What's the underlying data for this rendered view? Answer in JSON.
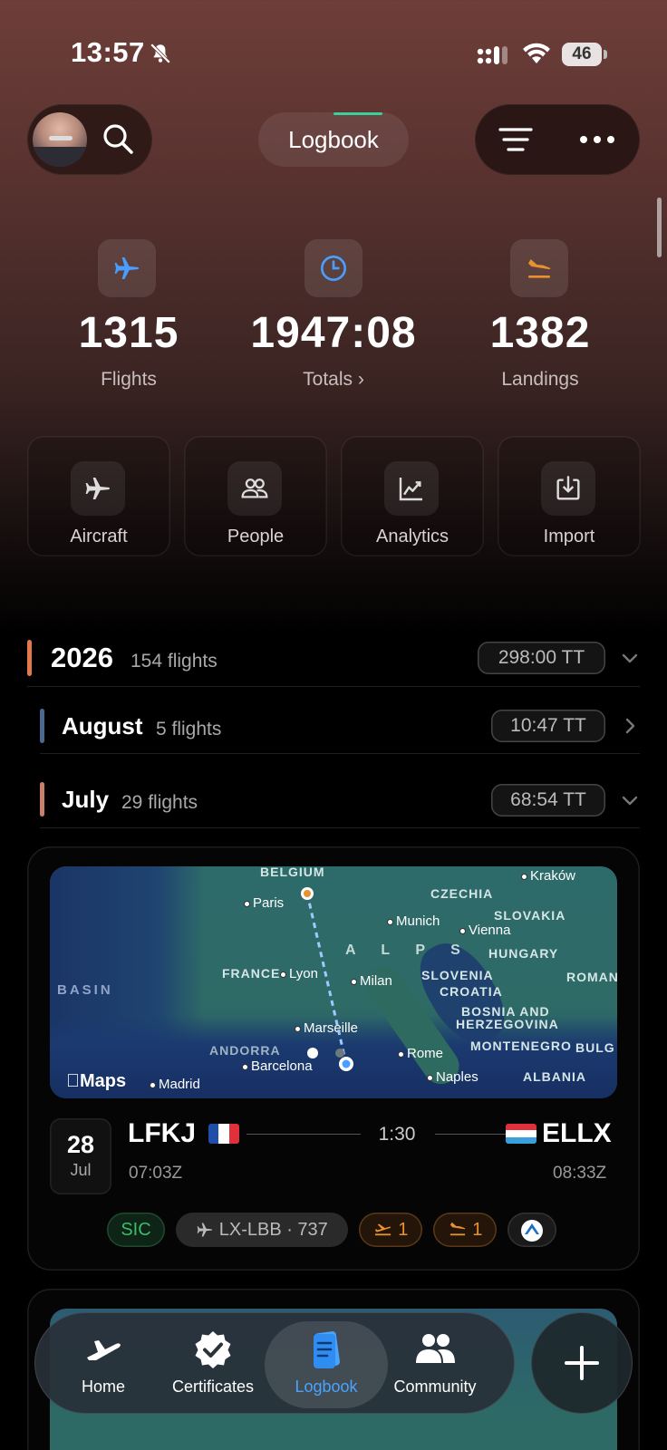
{
  "status_bar": {
    "time": "13:57",
    "battery": "46"
  },
  "header": {
    "title": "Logbook"
  },
  "stats": [
    {
      "value": "1315",
      "label": "Flights",
      "icon": "plane-icon"
    },
    {
      "value": "1947:08",
      "label": "Totals ›",
      "icon": "clock-icon"
    },
    {
      "value": "1382",
      "label": "Landings",
      "icon": "landing-icon"
    }
  ],
  "tiles": [
    {
      "label": "Aircraft",
      "icon": "plane-icon"
    },
    {
      "label": "People",
      "icon": "people-icon"
    },
    {
      "label": "Analytics",
      "icon": "chart-icon"
    },
    {
      "label": "Import",
      "icon": "import-icon"
    }
  ],
  "sections": {
    "year": {
      "title": "2026",
      "count": "154 flights",
      "tt": "298:00",
      "tt_unit": "TT",
      "color": "#e07a4a"
    },
    "august": {
      "title": "August",
      "count": "5 flights",
      "tt": "10:47",
      "tt_unit": "TT",
      "color": "#4c6890"
    },
    "july": {
      "title": "July",
      "count": "29 flights",
      "tt": "68:54",
      "tt_unit": "TT",
      "color": "#c9806a"
    }
  },
  "flight": {
    "day": "28",
    "month": "Jul",
    "from_icao": "LFKJ",
    "from_time": "07:03Z",
    "to_icao": "ELLX",
    "to_time": "08:33Z",
    "duration": "1:30",
    "role": "SIC",
    "aircraft": "LX-LBB · 737",
    "takeoffs": "1",
    "landings": "1"
  },
  "map": {
    "brand": "Maps",
    "labels": [
      "BELGIUM",
      "CZECHIA",
      "SLOVAKIA",
      "HUNGARY",
      "FRANCE",
      "SLOVENIA",
      "CROATIA",
      "BOSNIA AND",
      "HERZEGOVINA",
      "MONTENEGRO",
      "ALBANIA",
      "ANDORRA",
      "BASIN",
      "ROMAN",
      "BULG",
      "A L P S"
    ],
    "cities": [
      "Kraków",
      "Paris",
      "Munich",
      "Vienna",
      "Lyon",
      "Milan",
      "Marseille",
      "Barcelona",
      "Rome",
      "Naples",
      "Madrid"
    ]
  },
  "tabs": [
    {
      "label": "Home"
    },
    {
      "label": "Certificates"
    },
    {
      "label": "Logbook"
    },
    {
      "label": "Community"
    }
  ],
  "colors": {
    "accent_blue": "#4a9eff",
    "landing_orange": "#e8922e",
    "sic_green": "#3dbb6a"
  }
}
